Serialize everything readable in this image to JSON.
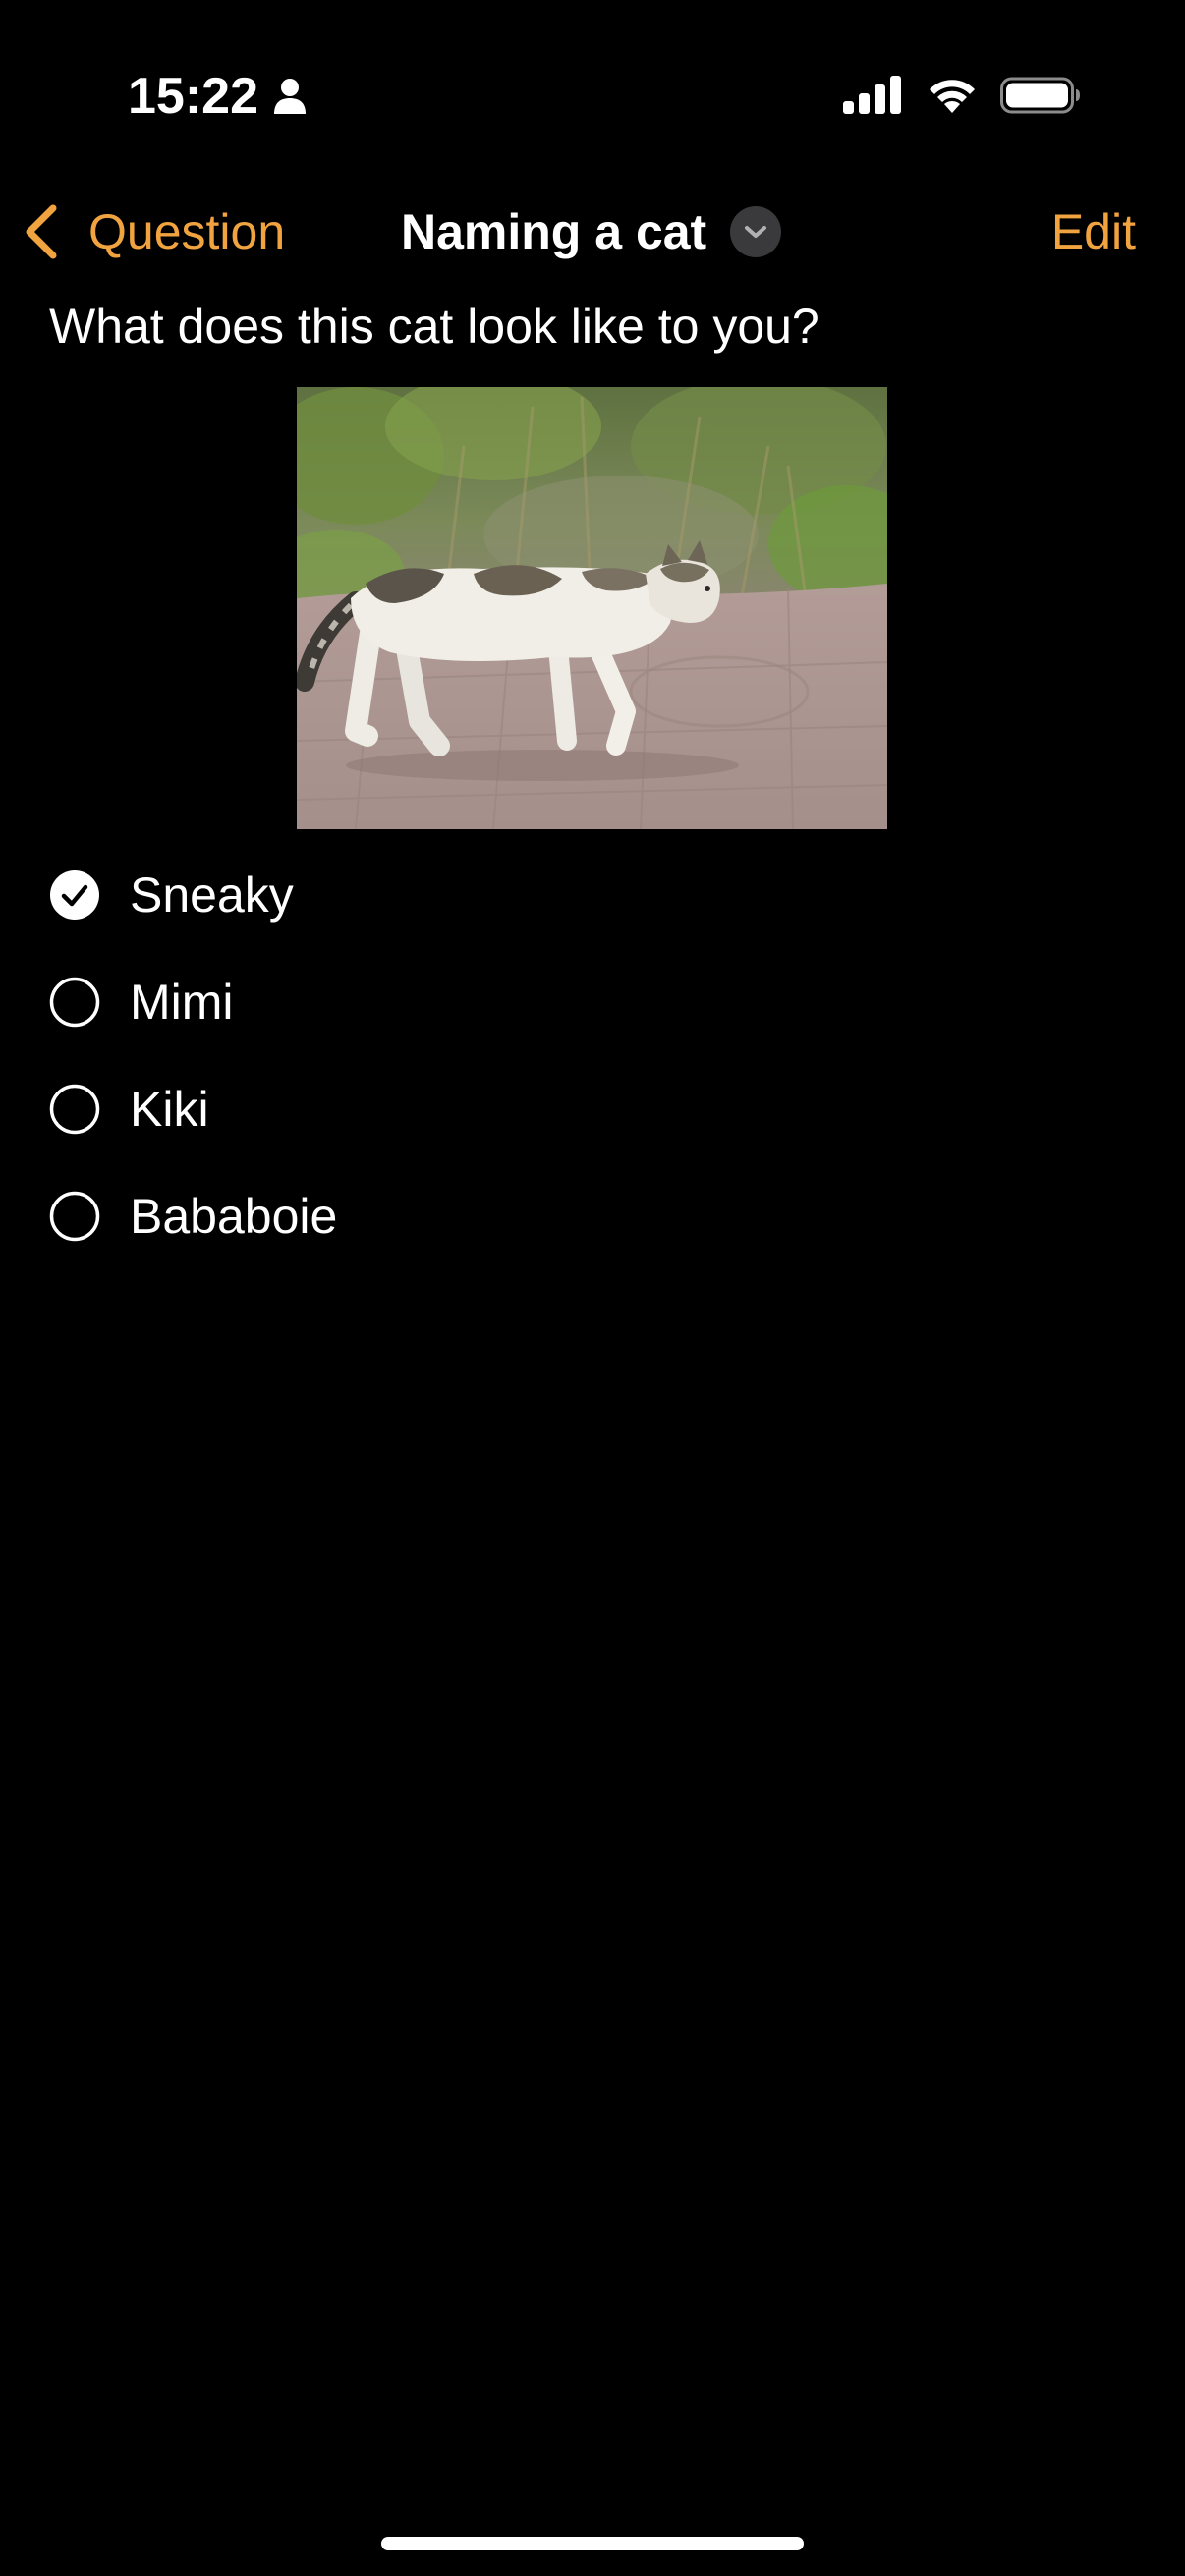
{
  "status_bar": {
    "time": "15:22",
    "person_icon": "person-icon",
    "signal_icon": "cellular-signal-icon",
    "wifi_icon": "wifi-icon",
    "battery_icon": "battery-icon"
  },
  "nav": {
    "back_label": "Question",
    "title": "Naming a cat",
    "edit_label": "Edit",
    "accent_color": "#f1a33f"
  },
  "question": {
    "text": "What does this cat look like to you?"
  },
  "options": [
    {
      "label": "Sneaky",
      "selected": true
    },
    {
      "label": "Mimi",
      "selected": false
    },
    {
      "label": "Kiki",
      "selected": false
    },
    {
      "label": "Bababoie",
      "selected": false
    }
  ]
}
